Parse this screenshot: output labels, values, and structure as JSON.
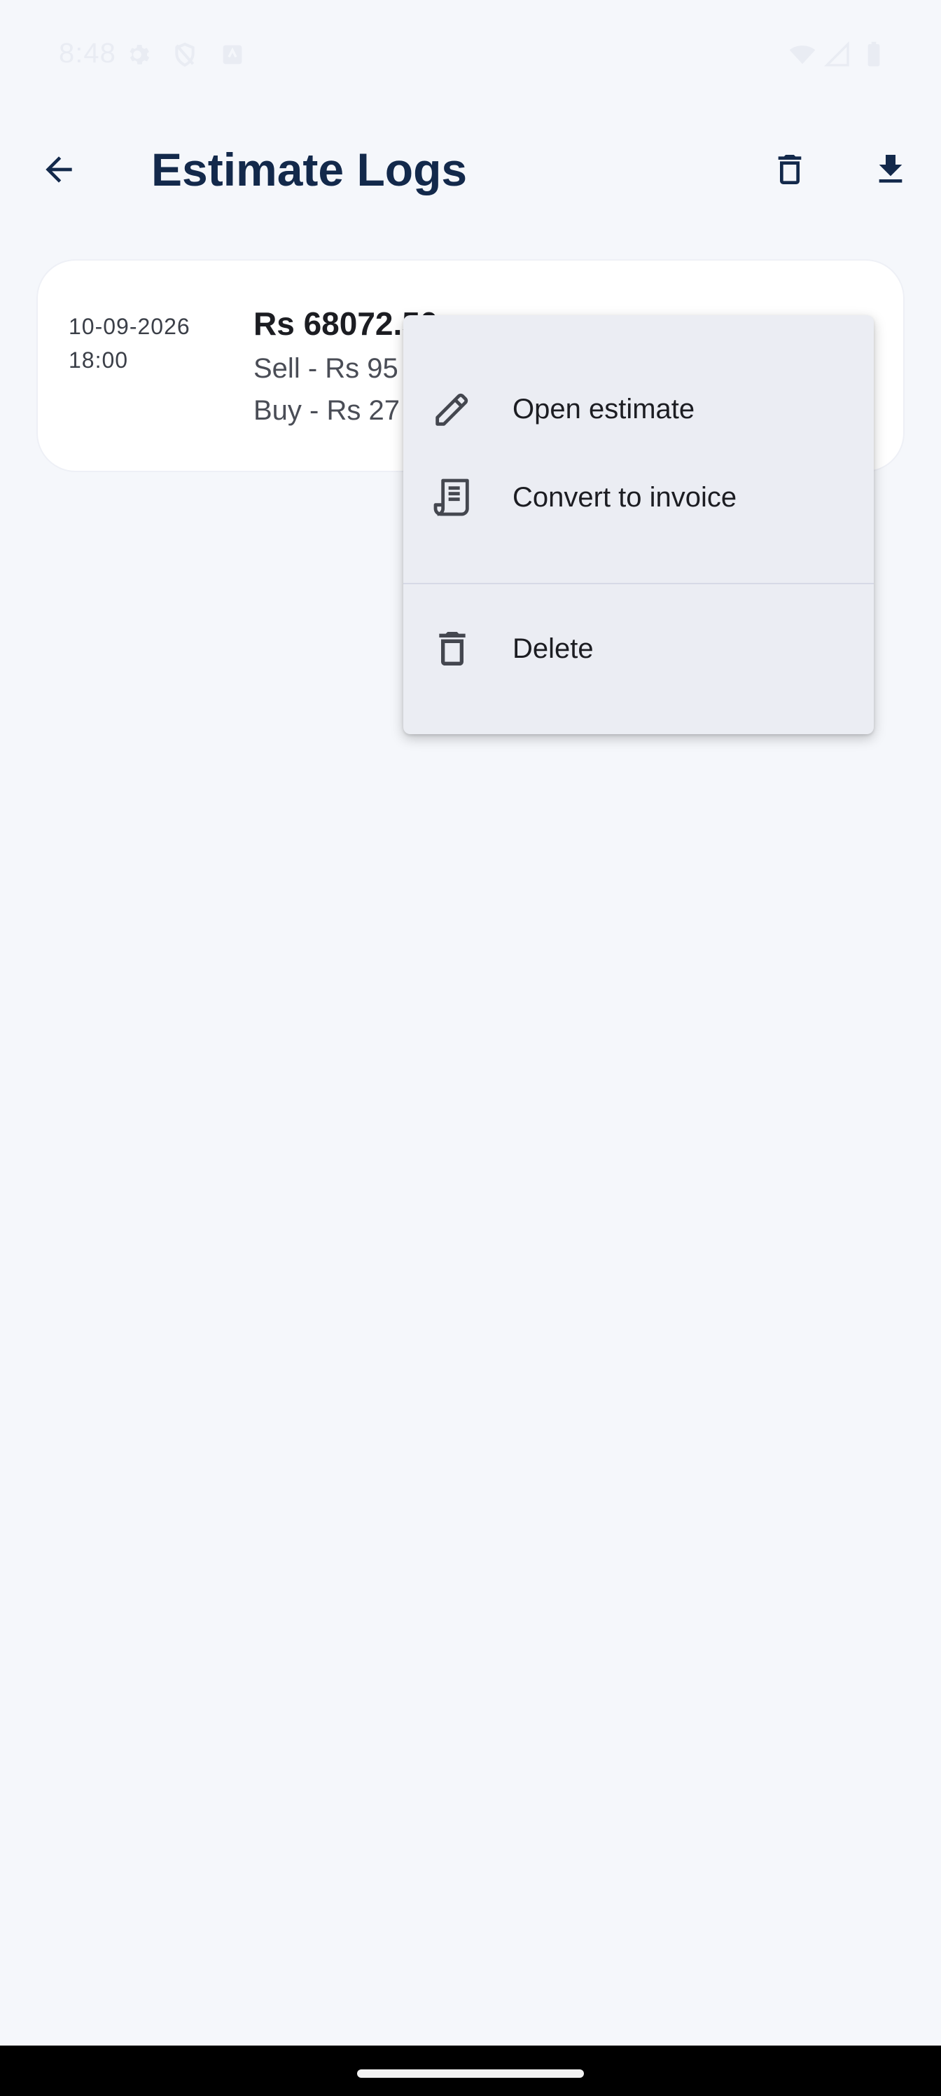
{
  "status_bar": {
    "time": "8:48",
    "icons": [
      "settings-icon",
      "shield-icon",
      "keyboard-icon",
      "wifi-icon",
      "signal-icon",
      "battery-icon"
    ]
  },
  "app_bar": {
    "title": "Estimate Logs",
    "back_icon": "arrow-back-icon",
    "actions": [
      "delete-icon",
      "download-icon"
    ]
  },
  "log_entry": {
    "date": "10-09-2026",
    "time": "18:00",
    "amount": "Rs 68072.50",
    "sell": "Sell - Rs 95",
    "buy": "Buy - Rs 27"
  },
  "menu": {
    "items": [
      {
        "label": "Open estimate",
        "icon": "pencil-icon"
      },
      {
        "label": "Convert to invoice",
        "icon": "receipt-icon"
      },
      {
        "label": "Delete",
        "icon": "trash-icon"
      }
    ]
  },
  "colors": {
    "background": "#f5f7fb",
    "title": "#13294b",
    "menu_bg": "#ebedf3",
    "card_bg": "#ffffff"
  }
}
